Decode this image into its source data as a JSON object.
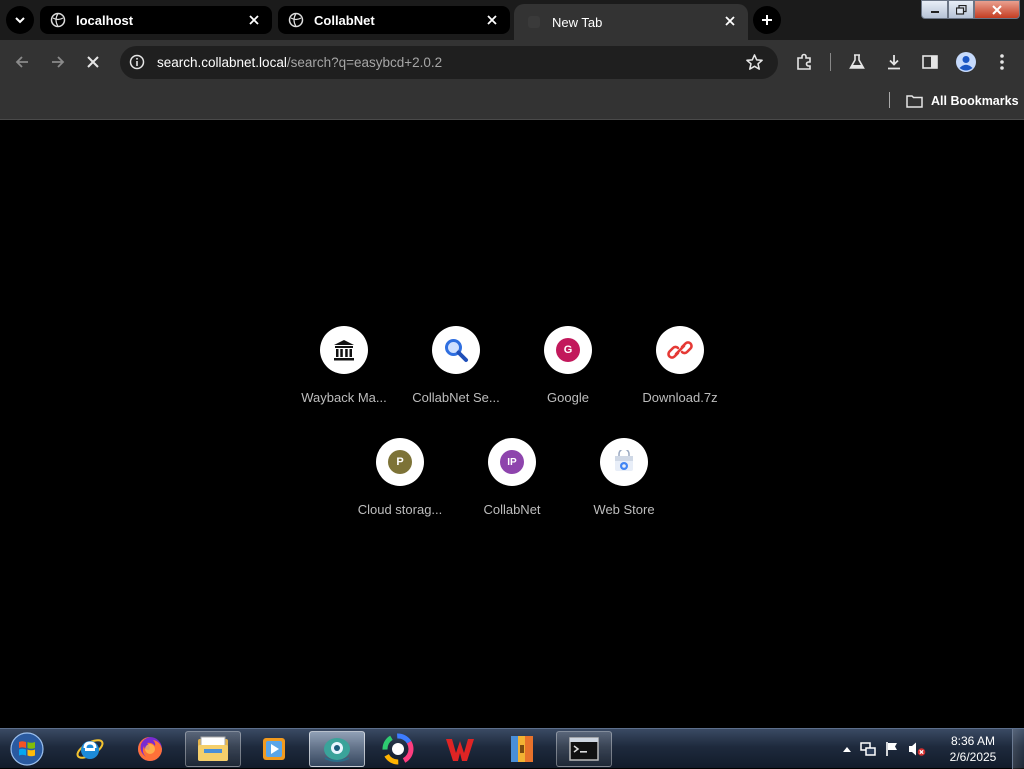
{
  "browser": {
    "tabs": [
      {
        "title": "localhost"
      },
      {
        "title": "CollabNet"
      },
      {
        "title": "New Tab"
      }
    ],
    "omnibox": {
      "host": "search.collabnet.local",
      "path": "/search?q=easybcd+2.0.2"
    },
    "bookmarks": {
      "all_label": "All Bookmarks"
    }
  },
  "shortcuts": [
    {
      "label": "Wayback Ma...",
      "icon": "museum-icon"
    },
    {
      "label": "CollabNet Se...",
      "icon": "search-icon"
    },
    {
      "label": "Google",
      "icon": "letter-icon",
      "letter": "G",
      "color": "#c2185b"
    },
    {
      "label": "Download.7z",
      "icon": "link-icon",
      "color": "#e53935"
    },
    {
      "label": "Cloud storag...",
      "icon": "letter-icon",
      "letter": "P",
      "color": "#7d7337"
    },
    {
      "label": "CollabNet",
      "icon": "letter-icon",
      "letter": "IP",
      "color": "#8e44ad"
    },
    {
      "label": "Web Store",
      "icon": "web-store-icon"
    }
  ],
  "taskbar": {
    "apps": [
      "internet-explorer",
      "firefox",
      "file-explorer",
      "media-player",
      "active-app",
      "color-app",
      "wps-office",
      "archive-manager",
      "command-prompt"
    ],
    "clock": {
      "time": "8:36 AM",
      "date": "2/6/2025"
    }
  },
  "colors": {
    "accent": "#8ab4f8",
    "toolbar": "#333333",
    "content_bg": "#000000"
  }
}
